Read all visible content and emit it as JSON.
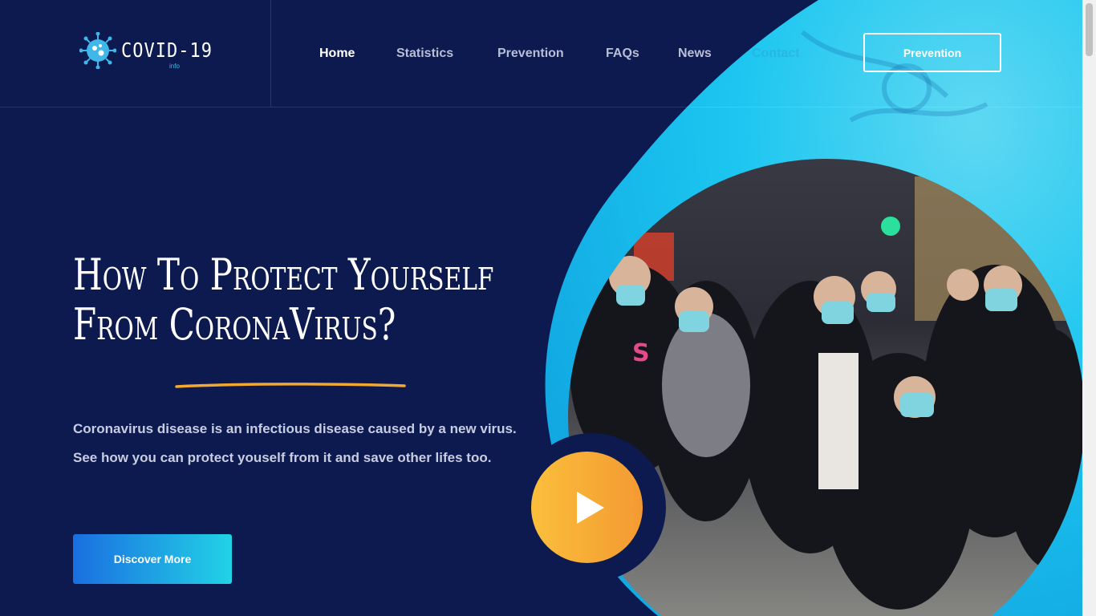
{
  "logo": {
    "text": "COVID-19",
    "sub": "info"
  },
  "nav": {
    "items": [
      {
        "label": "Home",
        "active": true
      },
      {
        "label": "Statistics",
        "active": false
      },
      {
        "label": "Prevention",
        "active": false
      },
      {
        "label": "FAQs",
        "active": false
      },
      {
        "label": "News",
        "active": false
      },
      {
        "label": "Contact",
        "active": false
      }
    ],
    "cta_label": "Prevention"
  },
  "hero": {
    "title_line1": "How To Protect Yourself",
    "title_line2_prefix": "From ",
    "title_line2_highlight": "CoronaVirus?",
    "description": "Coronavirus disease is an infectious disease caused by a new virus. See how you can protect youself from it and save other lifes too.",
    "cta_label": "Discover More"
  },
  "colors": {
    "background": "#0c1a50",
    "accent_cyan": "#1cc6f0",
    "play_orange": "#f5a833",
    "underline_yellow": "#f3a832"
  },
  "icons": {
    "play": "play-icon",
    "logo": "virus-icon"
  }
}
